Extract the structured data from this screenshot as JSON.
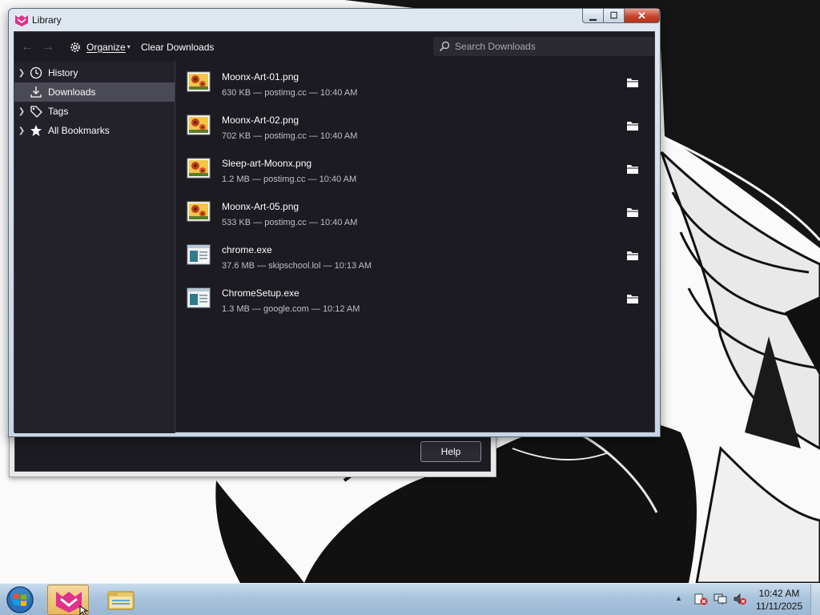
{
  "window": {
    "title": "Library",
    "controls": {
      "minimize": "▁",
      "maximize": "☐",
      "close": "✕"
    }
  },
  "toolbar": {
    "back_icon": "←",
    "forward_icon": "→",
    "organize_label": "Organize",
    "organize_caret": "▾",
    "clear_label": "Clear Downloads",
    "search_placeholder": "Search Downloads"
  },
  "sidebar": {
    "items": [
      {
        "label": "History",
        "icon": "clock-icon",
        "expandable": true,
        "selected": false
      },
      {
        "label": "Downloads",
        "icon": "download-icon",
        "expandable": false,
        "selected": true
      },
      {
        "label": "Tags",
        "icon": "tag-icon",
        "expandable": true,
        "selected": false
      },
      {
        "label": "All Bookmarks",
        "icon": "star-icon",
        "expandable": true,
        "selected": false
      }
    ]
  },
  "downloads": [
    {
      "name": "Moonx-Art-01.png",
      "status": "630 KB — postimg.cc — 10:40 AM",
      "icon": "image-file-icon"
    },
    {
      "name": "Moonx-Art-02.png",
      "status": "702 KB — postimg.cc — 10:40 AM",
      "icon": "image-file-icon"
    },
    {
      "name": "Sleep-art-Moonx.png",
      "status": "1.2 MB — postimg.cc — 10:40 AM",
      "icon": "image-file-icon"
    },
    {
      "name": "Moonx-Art-05.png",
      "status": "533 KB — postimg.cc — 10:40 AM",
      "icon": "image-file-icon"
    },
    {
      "name": "chrome.exe",
      "status": "37.6 MB — skipschool.lol — 10:13 AM",
      "icon": "executable-file-icon"
    },
    {
      "name": "ChromeSetup.exe",
      "status": "1.3 MB — google.com — 10:12 AM",
      "icon": "executable-file-icon"
    }
  ],
  "background_dialog": {
    "help_label": "Help"
  },
  "taskbar": {
    "clock_time": "10:42 AM",
    "clock_date": "11/11/2025",
    "tray_arrow": "▲"
  },
  "colors": {
    "panel_bg": "#1c1b22",
    "sidebar_bg": "#23222b",
    "selected_bg": "#4a4a55",
    "text": "#fbfbfe",
    "secondary_text": "#bfbfc9"
  }
}
